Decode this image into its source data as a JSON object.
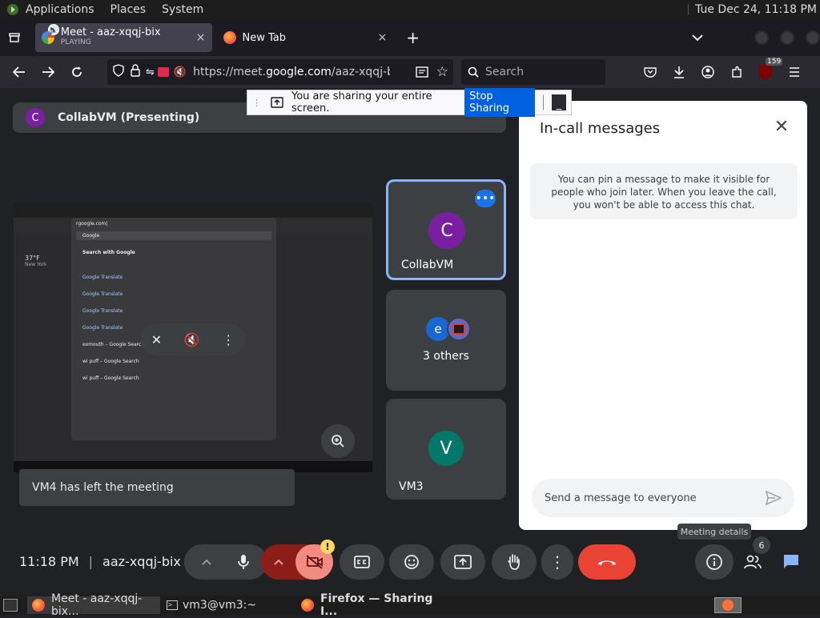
{
  "gnome": {
    "menus": [
      "Applications",
      "Places",
      "System"
    ],
    "clock": "Tue Dec 24, 11:18 PM"
  },
  "tabs": [
    {
      "title": "Meet - aaz-xqqj-bix",
      "subtitle": "PLAYING",
      "close": "×"
    },
    {
      "title": "New Tab",
      "close": "×"
    }
  ],
  "tab_new": "+",
  "nav": {
    "url_prefix": "https://meet.",
    "url_domain": "google.com",
    "url_rest": "/aaz-xqqj-bix?",
    "search_placeholder": "Search",
    "badge_count": "159"
  },
  "share_banner": {
    "text": "You are sharing your entire screen.",
    "stop_label": "Stop Sharing",
    "minimize": "_"
  },
  "presenter": {
    "initial": "C",
    "name": "CollabVM (Presenting)"
  },
  "shared_screen": {
    "search_text": "rgoogle.com|",
    "weather_temp": "37°F",
    "weather_place": "New York",
    "items": [
      "Google",
      "Search with Google",
      "Google Translate",
      "Google Translate",
      "Google Translate",
      "Google Translate",
      "exmouth – Google Search",
      "wi puff – Google Search",
      "wi puff – Google Search"
    ]
  },
  "tiles": [
    {
      "initial": "C",
      "name": "CollabVM",
      "color": "#7b1fa2"
    },
    {
      "initial": "e",
      "name": "3 others",
      "color": "#1967d2"
    },
    {
      "initial": "V",
      "name": "VM3",
      "color": "#00796b"
    }
  ],
  "toast": "VM4 has left the meeting",
  "chat": {
    "title": "In-call messages",
    "close": "✕",
    "info": "You can pin a message to make it visible for people who join later. When you leave the call, you won't be able to access this chat.",
    "input_placeholder": "Send a message to everyone"
  },
  "tooltip": "Meeting details",
  "meeting": {
    "time": "11:18 PM",
    "code": "aaz-xqqj-bix",
    "people_count": "6",
    "warning": "!"
  },
  "taskbar": [
    {
      "label": "Meet - aaz-xqqj-bix..."
    },
    {
      "label": "vm3@vm3:~"
    },
    {
      "label": "Firefox — Sharing I..."
    }
  ],
  "colors": {
    "meet_bg": "#202124",
    "tile_bg": "#3c4043",
    "hangup_red": "#ea4335",
    "camera_off": "#8c1d18",
    "active_tile_border": "#8ab4f8",
    "chat_send": "#1a73e8"
  }
}
